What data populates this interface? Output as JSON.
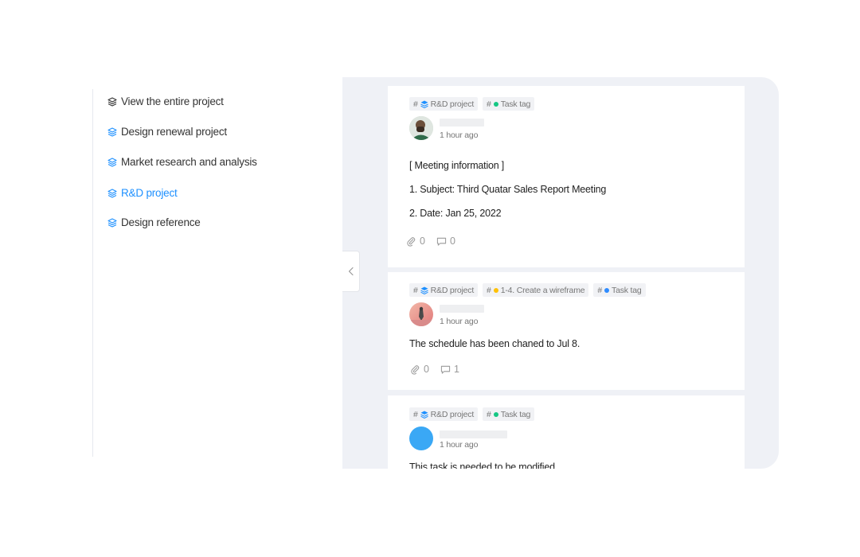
{
  "sidebar": {
    "items": [
      {
        "label": "View the entire project"
      },
      {
        "label": "Design renewal project"
      },
      {
        "label": "Market research and analysis"
      },
      {
        "label": "R&D project"
      },
      {
        "label": "Design reference"
      }
    ]
  },
  "feed": {
    "cards": [
      {
        "tags": [
          {
            "hash": "#",
            "label": "R&D project",
            "icon": "stack-icon"
          },
          {
            "hash": "#",
            "label": "Task tag",
            "dot_color": "#16c784"
          }
        ],
        "time": "1 hour ago",
        "lines": [
          "[ Meeting information ]",
          "1.   Subject: Third Quatar Sales Report Meeting",
          "2.   Date: Jan 25, 2022"
        ],
        "attachments": "0",
        "comments": "0"
      },
      {
        "tags": [
          {
            "hash": "#",
            "label": "R&D project",
            "icon": "stack-icon"
          },
          {
            "hash": "#",
            "label": "1-4. Create a wireframe",
            "dot_color": "#ffc107"
          },
          {
            "hash": "#",
            "label": "Task tag",
            "dot_color": "#2f8cff"
          }
        ],
        "time": "1 hour ago",
        "lines": [
          "The schedule has been chaned to Jul 8."
        ],
        "attachments": "0",
        "comments": "1"
      },
      {
        "tags": [
          {
            "hash": "#",
            "label": "R&D project",
            "icon": "stack-icon"
          },
          {
            "hash": "#",
            "label": "Task tag",
            "dot_color": "#16c784"
          }
        ],
        "time": "1 hour ago",
        "lines": [
          "This task is needed to be modified"
        ]
      }
    ]
  },
  "colors": {
    "accent": "#1e90ff",
    "feed_bg": "#eff1f6",
    "tag_bg": "#f1f2f5",
    "avatar_blue": "#3aa8f5"
  }
}
